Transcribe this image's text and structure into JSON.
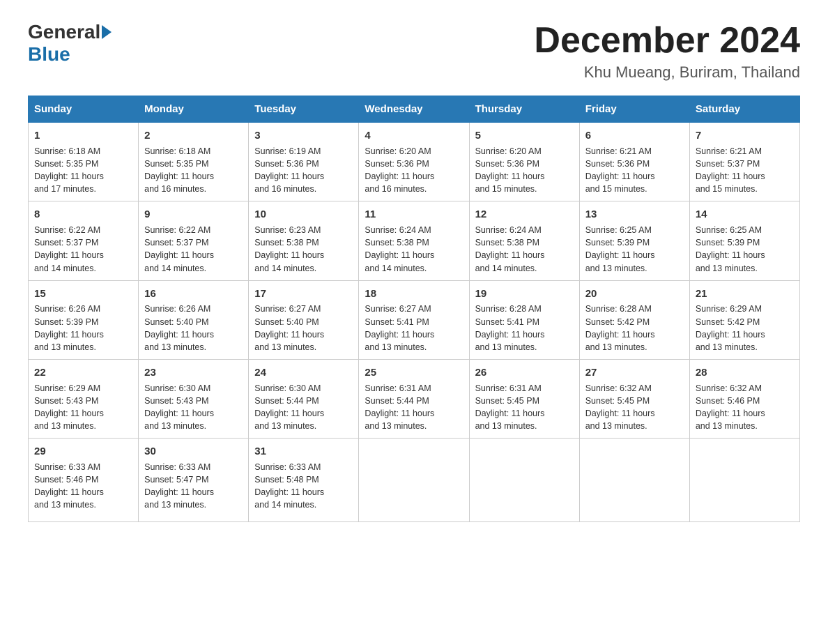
{
  "logo": {
    "general": "General",
    "blue": "Blue"
  },
  "title": {
    "month": "December 2024",
    "location": "Khu Mueang, Buriram, Thailand"
  },
  "weekdays": [
    "Sunday",
    "Monday",
    "Tuesday",
    "Wednesday",
    "Thursday",
    "Friday",
    "Saturday"
  ],
  "weeks": [
    [
      {
        "day": "1",
        "info": "Sunrise: 6:18 AM\nSunset: 5:35 PM\nDaylight: 11 hours\nand 17 minutes."
      },
      {
        "day": "2",
        "info": "Sunrise: 6:18 AM\nSunset: 5:35 PM\nDaylight: 11 hours\nand 16 minutes."
      },
      {
        "day": "3",
        "info": "Sunrise: 6:19 AM\nSunset: 5:36 PM\nDaylight: 11 hours\nand 16 minutes."
      },
      {
        "day": "4",
        "info": "Sunrise: 6:20 AM\nSunset: 5:36 PM\nDaylight: 11 hours\nand 16 minutes."
      },
      {
        "day": "5",
        "info": "Sunrise: 6:20 AM\nSunset: 5:36 PM\nDaylight: 11 hours\nand 15 minutes."
      },
      {
        "day": "6",
        "info": "Sunrise: 6:21 AM\nSunset: 5:36 PM\nDaylight: 11 hours\nand 15 minutes."
      },
      {
        "day": "7",
        "info": "Sunrise: 6:21 AM\nSunset: 5:37 PM\nDaylight: 11 hours\nand 15 minutes."
      }
    ],
    [
      {
        "day": "8",
        "info": "Sunrise: 6:22 AM\nSunset: 5:37 PM\nDaylight: 11 hours\nand 14 minutes."
      },
      {
        "day": "9",
        "info": "Sunrise: 6:22 AM\nSunset: 5:37 PM\nDaylight: 11 hours\nand 14 minutes."
      },
      {
        "day": "10",
        "info": "Sunrise: 6:23 AM\nSunset: 5:38 PM\nDaylight: 11 hours\nand 14 minutes."
      },
      {
        "day": "11",
        "info": "Sunrise: 6:24 AM\nSunset: 5:38 PM\nDaylight: 11 hours\nand 14 minutes."
      },
      {
        "day": "12",
        "info": "Sunrise: 6:24 AM\nSunset: 5:38 PM\nDaylight: 11 hours\nand 14 minutes."
      },
      {
        "day": "13",
        "info": "Sunrise: 6:25 AM\nSunset: 5:39 PM\nDaylight: 11 hours\nand 13 minutes."
      },
      {
        "day": "14",
        "info": "Sunrise: 6:25 AM\nSunset: 5:39 PM\nDaylight: 11 hours\nand 13 minutes."
      }
    ],
    [
      {
        "day": "15",
        "info": "Sunrise: 6:26 AM\nSunset: 5:39 PM\nDaylight: 11 hours\nand 13 minutes."
      },
      {
        "day": "16",
        "info": "Sunrise: 6:26 AM\nSunset: 5:40 PM\nDaylight: 11 hours\nand 13 minutes."
      },
      {
        "day": "17",
        "info": "Sunrise: 6:27 AM\nSunset: 5:40 PM\nDaylight: 11 hours\nand 13 minutes."
      },
      {
        "day": "18",
        "info": "Sunrise: 6:27 AM\nSunset: 5:41 PM\nDaylight: 11 hours\nand 13 minutes."
      },
      {
        "day": "19",
        "info": "Sunrise: 6:28 AM\nSunset: 5:41 PM\nDaylight: 11 hours\nand 13 minutes."
      },
      {
        "day": "20",
        "info": "Sunrise: 6:28 AM\nSunset: 5:42 PM\nDaylight: 11 hours\nand 13 minutes."
      },
      {
        "day": "21",
        "info": "Sunrise: 6:29 AM\nSunset: 5:42 PM\nDaylight: 11 hours\nand 13 minutes."
      }
    ],
    [
      {
        "day": "22",
        "info": "Sunrise: 6:29 AM\nSunset: 5:43 PM\nDaylight: 11 hours\nand 13 minutes."
      },
      {
        "day": "23",
        "info": "Sunrise: 6:30 AM\nSunset: 5:43 PM\nDaylight: 11 hours\nand 13 minutes."
      },
      {
        "day": "24",
        "info": "Sunrise: 6:30 AM\nSunset: 5:44 PM\nDaylight: 11 hours\nand 13 minutes."
      },
      {
        "day": "25",
        "info": "Sunrise: 6:31 AM\nSunset: 5:44 PM\nDaylight: 11 hours\nand 13 minutes."
      },
      {
        "day": "26",
        "info": "Sunrise: 6:31 AM\nSunset: 5:45 PM\nDaylight: 11 hours\nand 13 minutes."
      },
      {
        "day": "27",
        "info": "Sunrise: 6:32 AM\nSunset: 5:45 PM\nDaylight: 11 hours\nand 13 minutes."
      },
      {
        "day": "28",
        "info": "Sunrise: 6:32 AM\nSunset: 5:46 PM\nDaylight: 11 hours\nand 13 minutes."
      }
    ],
    [
      {
        "day": "29",
        "info": "Sunrise: 6:33 AM\nSunset: 5:46 PM\nDaylight: 11 hours\nand 13 minutes."
      },
      {
        "day": "30",
        "info": "Sunrise: 6:33 AM\nSunset: 5:47 PM\nDaylight: 11 hours\nand 13 minutes."
      },
      {
        "day": "31",
        "info": "Sunrise: 6:33 AM\nSunset: 5:48 PM\nDaylight: 11 hours\nand 14 minutes."
      },
      {
        "day": "",
        "info": ""
      },
      {
        "day": "",
        "info": ""
      },
      {
        "day": "",
        "info": ""
      },
      {
        "day": "",
        "info": ""
      }
    ]
  ]
}
